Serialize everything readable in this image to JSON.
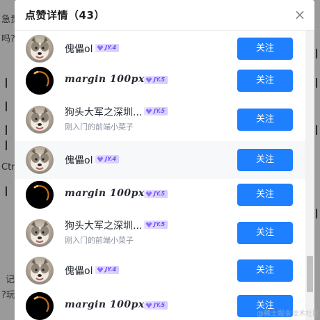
{
  "backdrop": {
    "fragments": [
      "急贵",
      "吗?",
      "Ctr",
      "记",
      "?玩"
    ]
  },
  "modal": {
    "title": "点赞详情（43）",
    "close_label": "×",
    "follow_label": "关注",
    "watermark": "@稀土掘金技术社区"
  },
  "users": [
    {
      "name": "傀儡ol",
      "level": "JY.4",
      "avatar": "husky-avatar",
      "bio": ""
    },
    {
      "name": "margin 100px",
      "level": "JY.5",
      "avatar": "eclipse-avatar",
      "bio": ""
    },
    {
      "name": "狗头大军之深圳...",
      "level": "JY.5",
      "avatar": "husky-avatar",
      "bio": "刚入门的前端小菜子"
    },
    {
      "name": "傀儡ol",
      "level": "JY.4",
      "avatar": "husky-avatar",
      "bio": ""
    },
    {
      "name": "margin 100px",
      "level": "JY.5",
      "avatar": "eclipse-avatar",
      "bio": ""
    },
    {
      "name": "狗头大军之深圳...",
      "level": "JY.5",
      "avatar": "husky-avatar",
      "bio": "刚入门的前端小菜子"
    },
    {
      "name": "傀儡ol",
      "level": "JY.4",
      "avatar": "husky-avatar",
      "bio": ""
    },
    {
      "name": "margin 100px",
      "level": "JY.5",
      "avatar": "eclipse-avatar",
      "bio": ""
    }
  ],
  "colors": {
    "accent": "#1e80ff",
    "badge": "#6c4df5"
  }
}
